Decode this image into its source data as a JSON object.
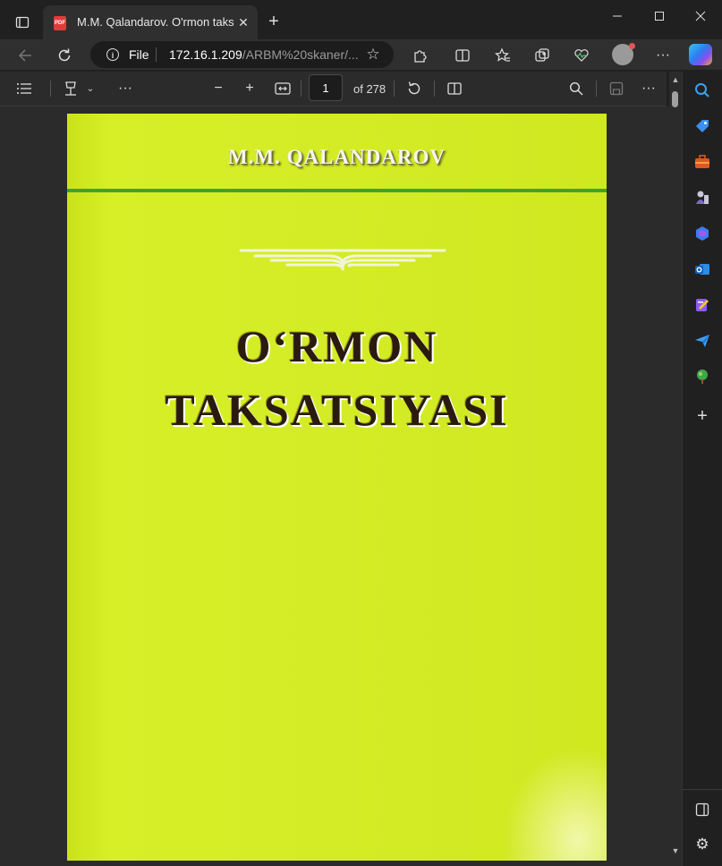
{
  "tab": {
    "title": "M.M. Qalandarov. O'rmon taksatsiyasi.pdf",
    "pdf_badge": "PDF"
  },
  "address": {
    "scheme_label": "File",
    "url_host": "172.16.1.209",
    "url_path": "/ARBM%20skaner/..."
  },
  "pdf_toolbar": {
    "page_current": "1",
    "page_total_label": "of 278"
  },
  "document": {
    "author": "M.M. QALANDAROV",
    "title_line1": "O‘RMON",
    "title_line2": "TAKSATSIYASI"
  },
  "icons": {
    "tab_actions": "tab-actions-icon",
    "back": "back-arrow-icon",
    "refresh": "refresh-icon",
    "info": "info-icon",
    "favorite": "star-icon",
    "extensions": "puzzle-icon",
    "split": "split-screen-icon",
    "favorites": "favorites-icon",
    "collections": "collections-icon",
    "health": "heartbeat-icon",
    "more": "more-icon",
    "contents": "contents-list-icon",
    "draw": "draw-icon",
    "zoom_out": "minus-icon",
    "zoom_in": "plus-icon",
    "fit": "fit-width-icon",
    "rotate": "rotate-icon",
    "page_view": "page-view-icon",
    "search": "search-icon",
    "save": "save-icon"
  },
  "colors": {
    "cover_green": "#d4ec25",
    "rule_green": "#3ba33a",
    "title_brown": "#2b1a0f"
  }
}
